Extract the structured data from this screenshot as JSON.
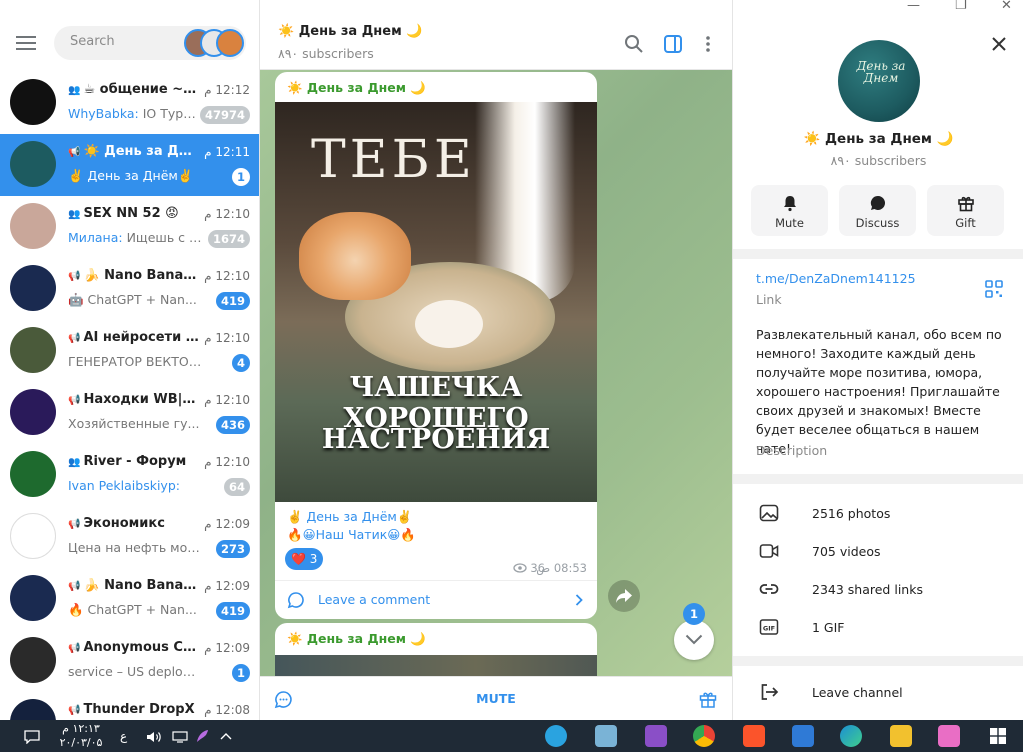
{
  "colors": {
    "accent": "#3390ec",
    "channel_author": "#3b9a2e",
    "badge_muted": "#c4c9cc",
    "taskbar": "#1f2a36"
  },
  "search": {
    "placeholder": "Search"
  },
  "chats": [
    {
      "title": "☕ общение ~ ...",
      "type": "group",
      "time": "12:12 م",
      "sender": "WhyBabka:",
      "preview": " IO Турех...",
      "badge": "47974",
      "muted": true,
      "active": false,
      "avatar_color": "#111111"
    },
    {
      "title": "☀️ День за Дне...",
      "type": "channel",
      "time": "12:11 م",
      "sender": "",
      "preview": "✌️ День за Днём✌️",
      "badge": "1",
      "muted": false,
      "active": true,
      "avatar_color": "#1d5b60"
    },
    {
      "title": "SEX NN 52 😡",
      "type": "group",
      "time": "12:10 م",
      "sender": "Милана:",
      "preview": " Ищешь с ке...",
      "badge": "1674",
      "muted": true,
      "active": false,
      "avatar_color": "#c9a79a"
    },
    {
      "title": "🍌 Nano Banan...",
      "type": "channel",
      "time": "12:10 م",
      "sender": "",
      "preview": "🤖 ChatGPT + Nan...",
      "badge": "419",
      "muted": false,
      "active": false,
      "avatar_color": "#1a2a50"
    },
    {
      "title": "AI нейросети и ...",
      "type": "channel",
      "time": "12:10 م",
      "sender": "",
      "preview": "ГЕНЕРАТОР ВЕКТОР...",
      "badge": "4",
      "muted": false,
      "active": false,
      "avatar_color": "#4a5a3a"
    },
    {
      "title": "Находки WB|OZ...",
      "type": "channel",
      "time": "12:10 م",
      "sender": "",
      "preview": "Хозяйственные гу...",
      "badge": "436",
      "muted": false,
      "active": false,
      "avatar_color": "#2a1a5a"
    },
    {
      "title": "River - Форум",
      "type": "group",
      "time": "12:10 م",
      "sender": "Ivan Peklaibskiyp:",
      "preview": "",
      "badge": "64",
      "muted": true,
      "active": false,
      "avatar_color": "#1e6a2e"
    },
    {
      "title": "Экономикс",
      "type": "channel",
      "time": "12:09 م",
      "sender": "",
      "preview": "Цена на нефть может...",
      "badge": "273",
      "muted": false,
      "active": false,
      "avatar_color": "#ffffff"
    },
    {
      "title": "🍌 Nano Banan...",
      "type": "channel",
      "time": "12:09 م",
      "sender": "",
      "preview": "🔥 ChatGPT + Nan...",
      "badge": "419",
      "muted": false,
      "active": false,
      "avatar_color": "#1a2a50"
    },
    {
      "title": "Anonymous Call...",
      "type": "channel",
      "time": "12:09 م",
      "sender": "",
      "preview": "service – US deployed 10...",
      "badge": "1",
      "muted": false,
      "active": false,
      "avatar_color": "#2a2a2a"
    },
    {
      "title": "Thunder DropX",
      "type": "channel",
      "time": "12:08 م",
      "sender": "",
      "preview": "",
      "badge": "",
      "muted": false,
      "active": false,
      "avatar_color": "#14213d"
    }
  ],
  "channel": {
    "title": "☀️ День за Днем 🌙",
    "subscribers": "۸۹۰ subscribers",
    "messages": [
      {
        "author": "☀️ День за Днем 🌙",
        "photo_text_top": "ТЕБЕ",
        "photo_text_line1": "ЧАШЕЧКА ХОРОШЕГО",
        "photo_text_line2": "НАСТРОЕНИЯ",
        "text_line1": "✌️ День за Днём✌️",
        "text_line2": "🔥😀Наш Чатик😀🔥",
        "reaction_emoji": "❤️",
        "reaction_count": "3",
        "views": "36",
        "time": "08:53 ص",
        "comment_label": "Leave a comment"
      },
      {
        "author": "☀️ День за Днем 🌙"
      }
    ],
    "scroll_badge": "1",
    "mute_label": "MUTE"
  },
  "info": {
    "avatar_text": "День за Днем",
    "title": "☀️ День за Днем 🌙",
    "subscribers": "۸۹۰ subscribers",
    "actions": [
      {
        "label": "Mute",
        "icon": "bell-icon"
      },
      {
        "label": "Discuss",
        "icon": "chat-bubble-icon"
      },
      {
        "label": "Gift",
        "icon": "gift-icon"
      }
    ],
    "link": "t.me/DenZaDnem141125",
    "link_label": "Link",
    "description": "Развлекательный канал, обо всем по немного! Заходите каждый день получайте море позитива, юмора, хорошего настроения! Приглашайте своих друзей и знакомых!  Вместе будет веселее общаться в нашем чате!",
    "description_label": "Description",
    "media": [
      {
        "label": "2516 photos",
        "icon": "photo-icon"
      },
      {
        "label": "705 videos",
        "icon": "video-icon"
      },
      {
        "label": "2343 shared links",
        "icon": "link-icon"
      },
      {
        "label": "1 GIF",
        "icon": "gif-icon"
      }
    ],
    "leave_label": "Leave channel"
  },
  "taskbar": {
    "time": "۱۲:۱۳ م",
    "date": "۲۰/۰۳/۰۵",
    "lang": "ع"
  }
}
